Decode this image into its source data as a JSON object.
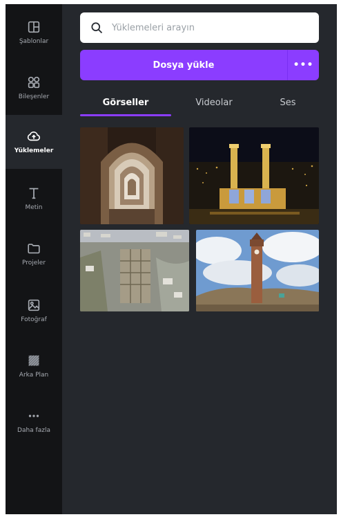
{
  "sidebar": {
    "items": [
      {
        "label": "Şablonlar",
        "icon": "template-icon",
        "active": false
      },
      {
        "label": "Bileşenler",
        "icon": "elements-icon",
        "active": false
      },
      {
        "label": "Yüklemeler",
        "icon": "upload-cloud-icon",
        "active": true
      },
      {
        "label": "Metin",
        "icon": "text-icon",
        "active": false
      },
      {
        "label": "Projeler",
        "icon": "folder-icon",
        "active": false
      },
      {
        "label": "Fotoğraf",
        "icon": "photo-icon",
        "active": false
      },
      {
        "label": "Arka Plan",
        "icon": "background-pattern-icon",
        "active": false
      },
      {
        "label": "Daha fazla",
        "icon": "more-dots-icon",
        "active": false
      }
    ]
  },
  "search": {
    "placeholder": "Yüklemeleri arayın",
    "icon": "search-icon"
  },
  "upload": {
    "label": "Dosya yükle",
    "more_label": "•••",
    "color": "#8b3dff"
  },
  "tabs": [
    {
      "label": "Görseller",
      "active": true
    },
    {
      "label": "Videolar",
      "active": false
    },
    {
      "label": "Ses",
      "active": false
    }
  ],
  "gallery": {
    "images": [
      {
        "name": "stone-archway-corridor-photo"
      },
      {
        "name": "night-minaret-city-photo"
      },
      {
        "name": "aerial-ruins-photo"
      },
      {
        "name": "clock-tower-photo"
      }
    ]
  },
  "colors": {
    "rail_bg": "#131416",
    "panel_bg": "#25282d",
    "accent": "#8b3dff"
  }
}
